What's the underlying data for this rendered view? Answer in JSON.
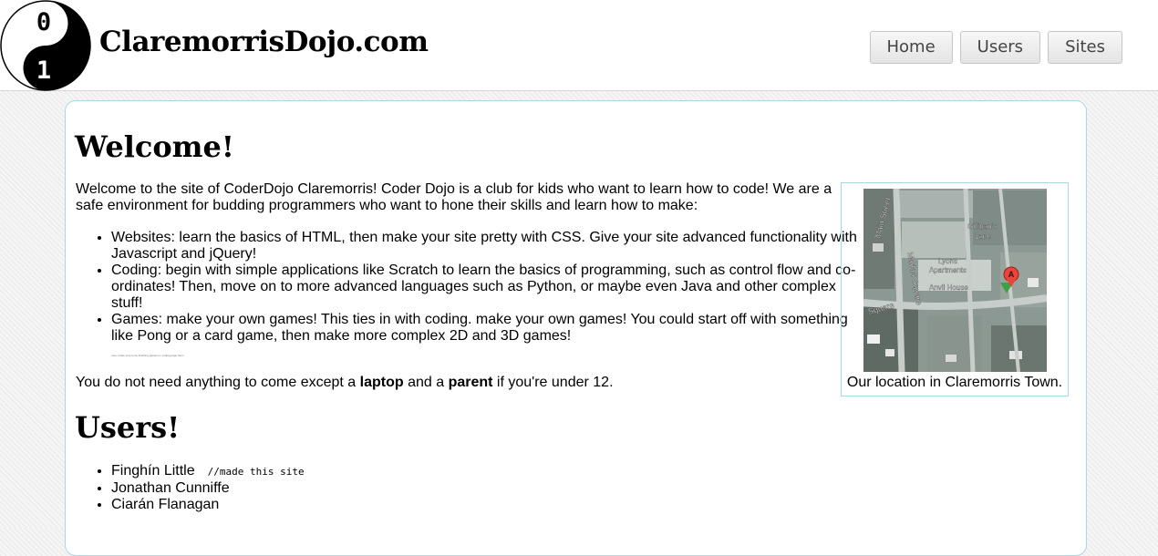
{
  "header": {
    "site_title": "ClaremorrisDojo.com",
    "logo": {
      "top_glyph": "0",
      "bottom_glyph": "1",
      "icon": "yin-yang-logo"
    },
    "nav": [
      {
        "label": "Home"
      },
      {
        "label": "Users"
      },
      {
        "label": "Sites"
      }
    ]
  },
  "main": {
    "welcome_heading": "Welcome!",
    "intro": "Welcome to the site of CoderDojo Claremorris! Coder Dojo is a club for kids who want to learn how to code! We are a safe environment for budding programmers who want to hone their skills and learn how to make:",
    "bullets": [
      "Websites: learn the basics of HTML, then make your site pretty with CSS. Give your site advanced functionality with Javascript and jQuery!",
      "Coding: begin with simple applications like Scratch to learn the basics of programming, such as control flow and co-ordinates! Then, move on to more advanced languages such as Python, or maybe even Java and other complex stuff!",
      "Games: make your own games! This ties in with coding. make your own games! You could start off with something like Pong or a card game, then make more complex 2D and 3D games!"
    ],
    "tiny_note": "note: make sure to be finishing games on coding page them",
    "closing": {
      "before": "You do not need anything to come except a ",
      "bold1": "laptop",
      "middle": " and a ",
      "bold2": "parent",
      "after": " if you're under 12."
    },
    "users_heading": "Users!",
    "users": [
      {
        "name": "Finghín Little",
        "comment": "//made this site"
      },
      {
        "name": "Jonathan Cunniffe",
        "comment": ""
      },
      {
        "name": "Ciarán Flanagan",
        "comment": ""
      }
    ]
  },
  "map_figure": {
    "caption": "Our location in Claremorris Town.",
    "labels": {
      "main_street": "Main Street",
      "gilligans_lane_1": "Gilligan's",
      "gilligans_lane_2": "Lane",
      "lyons_1": "Lyons",
      "lyons_2": "Apartments",
      "anvil_house": "Anvil House",
      "market_square": "Market Square",
      "square": "Square",
      "marker_letter": "A"
    },
    "marker_color": "#e8453c"
  },
  "colors": {
    "panel_border": "#a8d8e2",
    "nav_text": "#444444"
  }
}
